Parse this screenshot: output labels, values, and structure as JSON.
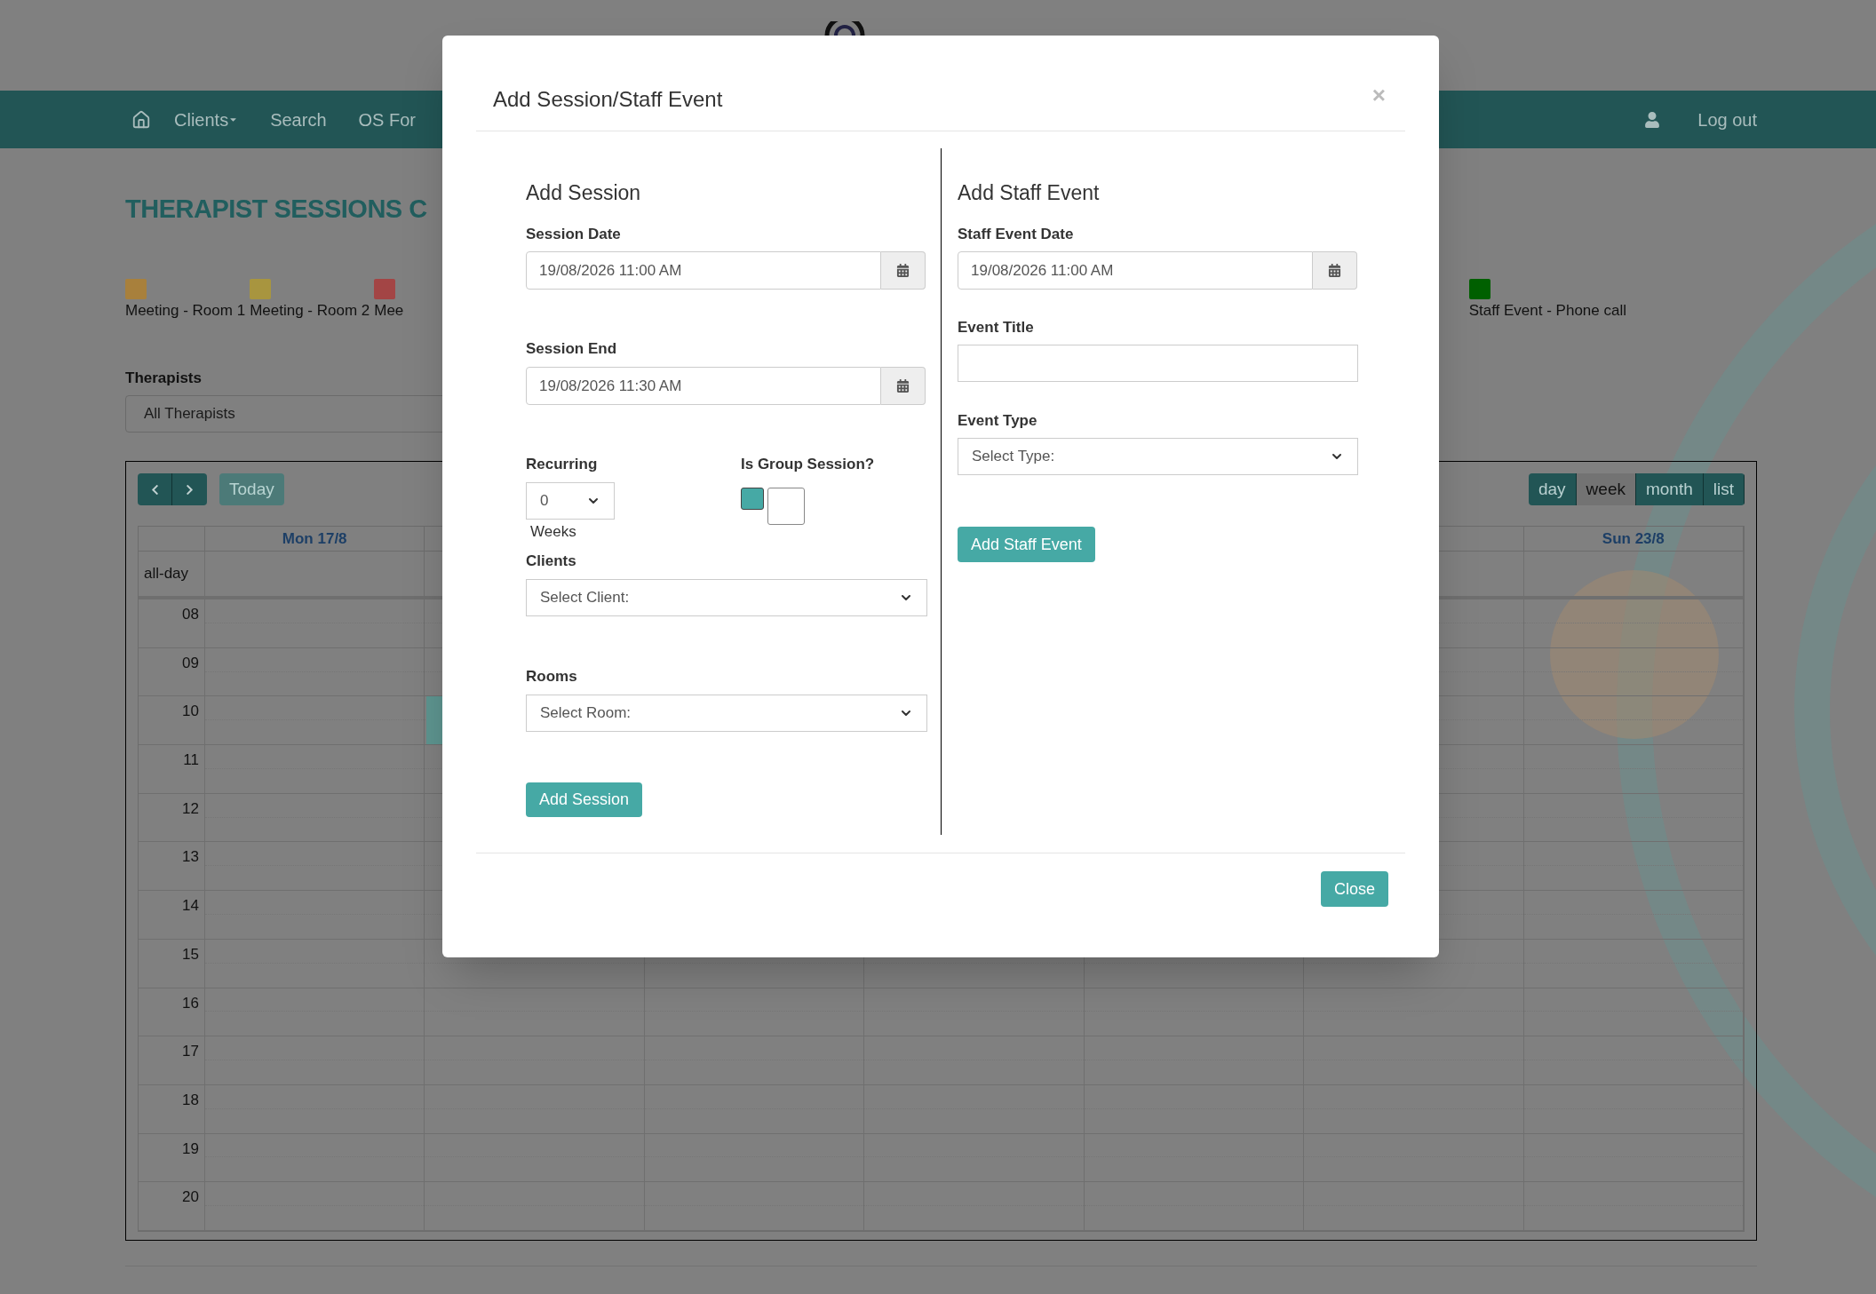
{
  "nav": {
    "items": [
      {
        "label": "Clients",
        "kind": "dropdown"
      },
      {
        "label": "Search",
        "kind": "link"
      },
      {
        "label": "OS For",
        "kind": "link"
      }
    ],
    "logout": "Log out"
  },
  "page_title": "THERAPIST SESSIONS C",
  "legend_left": [
    {
      "label": "Meeting - Room 1",
      "color": "#a8803c"
    },
    {
      "label": "Meeting - Room 2",
      "color": "#a8953f"
    },
    {
      "label": "Mee",
      "color": "#a34545"
    }
  ],
  "legend_right": [
    {
      "label": "Staff Event - Phone call",
      "color": "#006000"
    }
  ],
  "therapist_filter": {
    "label": "Therapists",
    "value": "All Therapists"
  },
  "calendar": {
    "today": {
      "label": "Today",
      "disabled": true
    },
    "views": [
      {
        "label": "day",
        "selected": false
      },
      {
        "label": "week",
        "selected": true
      },
      {
        "label": "month",
        "selected": false
      },
      {
        "label": "list",
        "selected": false
      }
    ],
    "first_day": "Mon 17/8",
    "last_day": "Sun 23/8",
    "all_day": "all-day",
    "hours": [
      "08",
      "09",
      "10",
      "11",
      "12",
      "13",
      "14",
      "15",
      "16",
      "17",
      "18",
      "19",
      "20"
    ]
  },
  "modal": {
    "title": "Add Session/Staff Event",
    "close_icon": "×",
    "session": {
      "heading": "Add Session",
      "date_label": "Session Date",
      "date_value": "19/08/2026 11:00 AM",
      "end_label": "Session End",
      "end_value": "19/08/2026 11:30 AM",
      "recurring_label": "Recurring",
      "recurring_value": "0",
      "weeks": "Weeks",
      "group_label": "Is Group Session?",
      "group_on": false,
      "clients_label": "Clients",
      "clients_value": "Select Client:",
      "rooms_label": "Rooms",
      "rooms_value": "Select Room:",
      "submit": "Add Session"
    },
    "staff": {
      "heading": "Add Staff Event",
      "date_label": "Staff Event Date",
      "date_value": "19/08/2026 11:00 AM",
      "title_label": "Event Title",
      "type_label": "Event Type",
      "type_value": "Select Type:",
      "submit": "Add Staff Event"
    },
    "close_button": "Close"
  }
}
